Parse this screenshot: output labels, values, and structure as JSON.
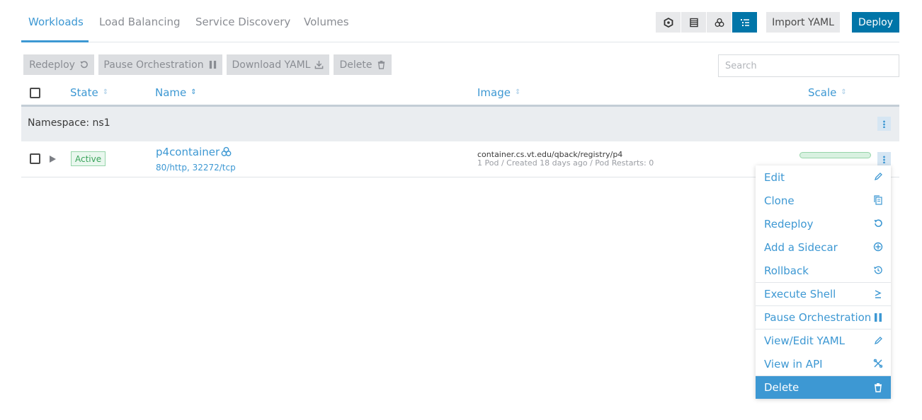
{
  "tabs": [
    {
      "label": "Workloads",
      "active": true
    },
    {
      "label": "Load Balancing"
    },
    {
      "label": "Service Discovery"
    },
    {
      "label": "Volumes"
    }
  ],
  "view_modes": [
    "group-none-icon",
    "list-icon",
    "cluster-icon",
    "tree-list-icon"
  ],
  "header_actions": {
    "import_label": "Import YAML",
    "deploy_label": "Deploy"
  },
  "actions": {
    "redeploy": "Redeploy",
    "pause": "Pause Orchestration",
    "download": "Download YAML",
    "delete": "Delete"
  },
  "search": {
    "placeholder": "Search",
    "value": ""
  },
  "columns": {
    "state": "State",
    "name": "Name",
    "image": "Image",
    "scale": "Scale"
  },
  "namespace": {
    "label": "Namespace: ns1"
  },
  "workload": {
    "state": "Active",
    "name": "p4container",
    "ports": "80/http, 32272/tcp",
    "image": "container.cs.vt.edu/qback/registry/p4",
    "meta": "1 Pod / Created 18 days ago / Pod Restarts: 0",
    "scale_fraction": 1.0
  },
  "menu": [
    {
      "label": "Edit",
      "icon": "pencil-icon"
    },
    {
      "label": "Clone",
      "icon": "copy-icon"
    },
    {
      "label": "Redeploy",
      "icon": "redeploy-icon"
    },
    {
      "label": "Add a Sidecar",
      "icon": "plus-circle-icon"
    },
    {
      "label": "Rollback",
      "icon": "history-icon"
    },
    {
      "label": "Execute Shell",
      "icon": "shell-icon"
    },
    {
      "label": "Pause Orchestration",
      "icon": "pause-icon"
    },
    {
      "label": "View/Edit YAML",
      "icon": "pencil-icon"
    },
    {
      "label": "View in API",
      "icon": "api-icon"
    },
    {
      "label": "Delete",
      "icon": "trash-icon"
    }
  ],
  "colors": {
    "accent": "#3d98d3",
    "primary": "#0075a8",
    "success": "#3aa35b"
  }
}
